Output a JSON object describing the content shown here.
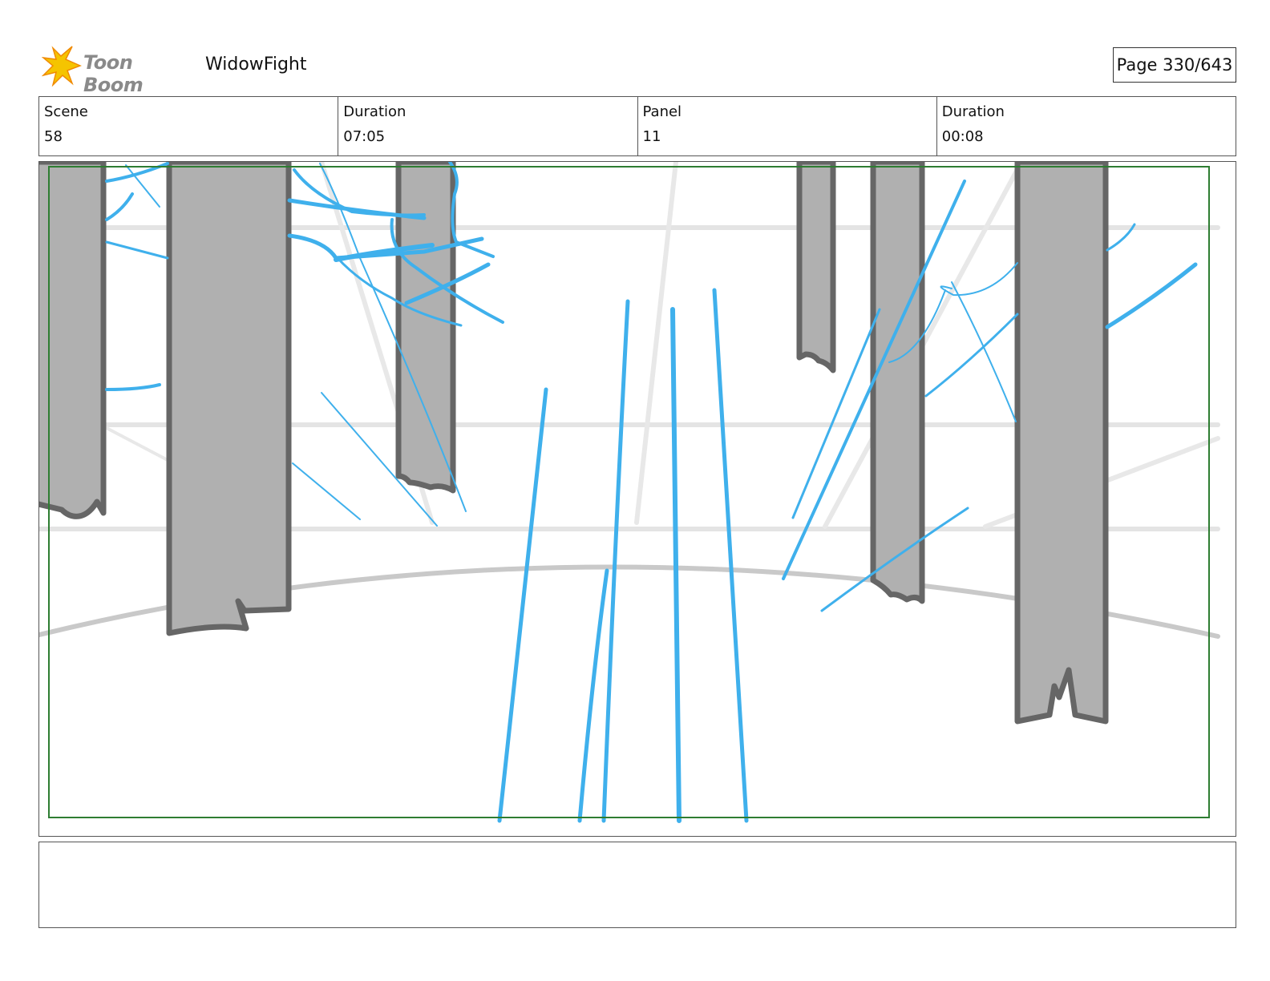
{
  "header": {
    "logo_text": "Toon Boom",
    "project_title": "WidowFight",
    "page_label": "Page 330/643"
  },
  "info": {
    "scene_label": "Scene",
    "scene_value": "58",
    "duration_label": "Duration",
    "duration_value": "07:05",
    "panel_label": "Panel",
    "panel_value": "11",
    "panel_duration_label": "Duration",
    "panel_duration_value": "00:08"
  },
  "notes": {
    "text": ""
  },
  "colors": {
    "sketch_blue": "#3fb0ec",
    "tree_fill": "#b0b0b0",
    "tree_outline": "#666666",
    "guide_gray": "#e4e4e4",
    "safe_frame": "#2e7d32",
    "logo_star": "#f5c400"
  }
}
